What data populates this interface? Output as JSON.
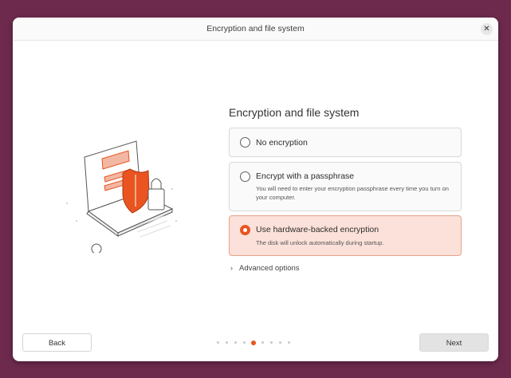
{
  "window": {
    "title": "Encryption and file system",
    "close_glyph": "✕"
  },
  "main": {
    "heading": "Encryption and file system",
    "options": [
      {
        "label": "No encryption",
        "description": "",
        "selected": false
      },
      {
        "label": "Encrypt with a passphrase",
        "description": "You will need to enter your encryption passphrase every time you turn on your computer.",
        "selected": false
      },
      {
        "label": "Use hardware-backed encryption",
        "description": "The disk will unlock automatically during startup.",
        "selected": true
      }
    ],
    "advanced_label": "Advanced options"
  },
  "footer": {
    "back_label": "Back",
    "next_label": "Next",
    "pager": {
      "total": 9,
      "current": 5
    }
  },
  "colors": {
    "accent": "#e95420",
    "background": "#6e2a4d",
    "selected_bg": "#fbe1d9"
  },
  "icons": [
    "close-icon",
    "radio-icon",
    "chevron-right-icon",
    "laptop-shield-illustration"
  ]
}
